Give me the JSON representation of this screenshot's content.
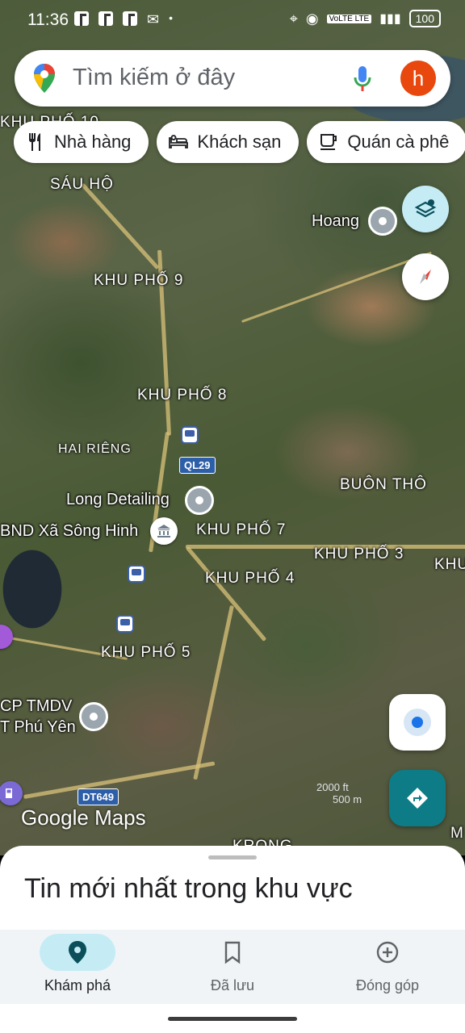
{
  "status_bar": {
    "time": "11:36",
    "network": "VoLTE LTE",
    "battery": "100"
  },
  "search": {
    "placeholder": "Tìm kiếm ở đây",
    "avatar_letter": "h"
  },
  "chips": [
    {
      "label": "Nhà hàng",
      "icon": "fork-knife-icon"
    },
    {
      "label": "Khách sạn",
      "icon": "bed-icon"
    },
    {
      "label": "Quán cà phê",
      "icon": "coffee-icon"
    }
  ],
  "map_labels": {
    "kp10": "KHU PHỐ 10",
    "sau_ho": "SÁU HỘ",
    "kp9": "KHU PHỐ 9",
    "kp8": "KHU PHỐ 8",
    "hai_rieng": "HAI RIÊNG",
    "kp7": "KHU PHỐ 7",
    "kp4": "KHU PHỐ 4",
    "kp3": "KHU PHỐ 3",
    "kp5": "KHU PHỐ 5",
    "buon_tho": "BUÔN THÔ",
    "khu_right": "KHU",
    "kbong": "KRONG",
    "m_edge": "M"
  },
  "places": {
    "hoang": "Hoang",
    "long_detailing": "Long Detailing",
    "ubnd": "BND Xã Sông Hinh",
    "cp_line1": "CP TMDV",
    "cp_line2": "T Phú Yên"
  },
  "road_shields": {
    "ql29": "QL29",
    "dt649": "DT649"
  },
  "logo": "Google Maps",
  "scale": {
    "ft": "2000 ft",
    "m": "500 m"
  },
  "sheet": {
    "title": "Tin mới nhất trong khu vực"
  },
  "nav": [
    {
      "label": "Khám phá",
      "icon": "explore-pin-icon",
      "active": true
    },
    {
      "label": "Đã lưu",
      "icon": "bookmark-icon",
      "active": false
    },
    {
      "label": "Đóng góp",
      "icon": "add-circle-icon",
      "active": false
    }
  ],
  "colors": {
    "accent": "#c5ecf5",
    "directions": "#0e7c86",
    "avatar": "#e8470d",
    "location_dot": "#1a73e8"
  }
}
